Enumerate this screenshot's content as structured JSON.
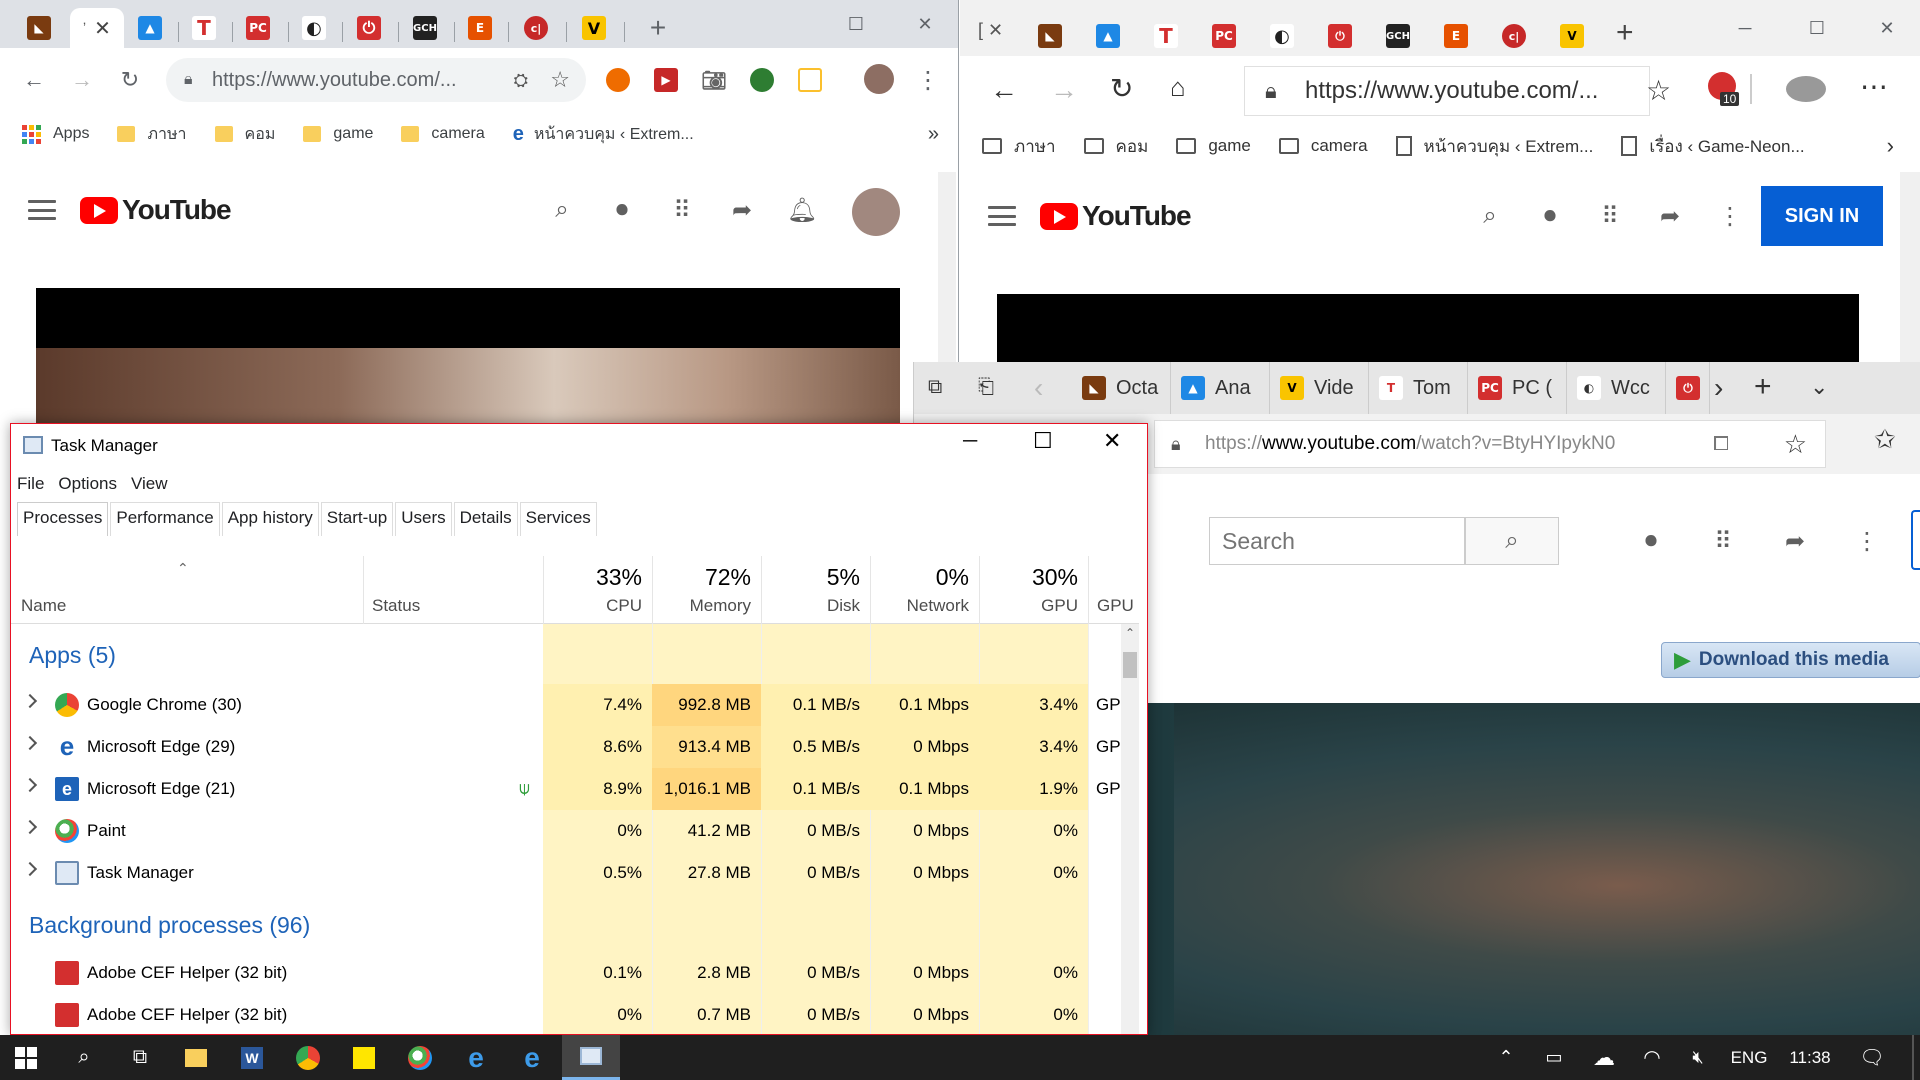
{
  "chrome": {
    "tabs": [
      {
        "icon": "game-icon",
        "color": "#b5651d"
      },
      {
        "title": "ʼ",
        "active": true
      },
      {
        "icon": "arch-icon",
        "color": "#1e88e5"
      },
      {
        "icon": "t-icon",
        "color": "#d32f2f",
        "glyph": "T"
      },
      {
        "icon": "pcgames-icon",
        "color": "#d32f2f",
        "glyph": "PC"
      },
      {
        "icon": "gauntlet-icon",
        "color": "#333333"
      },
      {
        "icon": "power-icon",
        "color": "#d32f2f"
      },
      {
        "icon": "gch-icon",
        "color": "#222222",
        "glyph": "GCH"
      },
      {
        "icon": "e-icon",
        "color": "#e65100",
        "glyph": "E"
      },
      {
        "icon": "c-icon",
        "color": "#c62828",
        "glyph": "c|"
      },
      {
        "icon": "v-icon",
        "color": "#f9c400",
        "glyph": "V"
      }
    ],
    "url": "https://www.youtube.com/...",
    "bookmarks": [
      {
        "label": "Apps",
        "type": "apps"
      },
      {
        "label": "ภาษา",
        "type": "folder"
      },
      {
        "label": "คอม",
        "type": "folder"
      },
      {
        "label": "game",
        "type": "folder"
      },
      {
        "label": "camera",
        "type": "folder"
      },
      {
        "label": "หน้าควบคุม ‹ Extrem...",
        "type": "page"
      }
    ],
    "bookmarks_more": "»",
    "youtube_logo": "YouTube"
  },
  "edge": {
    "url": "https://www.youtube.com/...",
    "extension_badge": "10",
    "bookmarks": [
      {
        "label": "ภาษา",
        "type": "folder"
      },
      {
        "label": "คอม",
        "type": "folder"
      },
      {
        "label": "game",
        "type": "folder"
      },
      {
        "label": "camera",
        "type": "folder"
      },
      {
        "label": "หน้าควบคุม ‹ Extrem...",
        "type": "page"
      },
      {
        "label": "เรื่อง ‹ Game-Neon...",
        "type": "page"
      }
    ],
    "youtube_logo": "YouTube",
    "sign_in": "SIGN IN"
  },
  "oldedge": {
    "tabs": [
      "Octa",
      "Ana",
      "Vide",
      "Tom",
      "PC (",
      "Wcc"
    ],
    "url_prefix": "https://",
    "url_host": "www.youtube.com",
    "url_path": "/watch?v=BtyHYIpykN0",
    "search_placeholder": "Search",
    "download_media": "Download this media"
  },
  "taskmgr": {
    "title": "Task Manager",
    "menu": [
      "File",
      "Options",
      "View"
    ],
    "tabs": [
      "Processes",
      "Performance",
      "App history",
      "Start-up",
      "Users",
      "Details",
      "Services"
    ],
    "columns": {
      "name": "Name",
      "status": "Status",
      "cpu": {
        "pct": "33%",
        "label": "CPU"
      },
      "memory": {
        "pct": "72%",
        "label": "Memory"
      },
      "disk": {
        "pct": "5%",
        "label": "Disk"
      },
      "network": {
        "pct": "0%",
        "label": "Network"
      },
      "gpu": {
        "pct": "30%",
        "label": "GPU"
      },
      "gpu_engine": "GPU E"
    },
    "groups": {
      "apps": "Apps (5)",
      "background": "Background processes (96)"
    },
    "apps": [
      {
        "name": "Google Chrome (30)",
        "icon": "chrome-icon",
        "cpu": "7.4%",
        "mem": "992.8 MB",
        "disk": "0.1 MB/s",
        "net": "0.1 Mbps",
        "gpu": "3.4%",
        "gpue": "GPU"
      },
      {
        "name": "Microsoft Edge (29)",
        "icon": "edge-icon",
        "cpu": "8.6%",
        "mem": "913.4 MB",
        "disk": "0.5 MB/s",
        "net": "0 Mbps",
        "gpu": "3.4%",
        "gpue": "GPU"
      },
      {
        "name": "Microsoft Edge (21)",
        "icon": "edge-legacy-icon",
        "cpu": "8.9%",
        "mem": "1,016.1 MB",
        "disk": "0.1 MB/s",
        "net": "0.1 Mbps",
        "gpu": "1.9%",
        "gpue": "GPU"
      },
      {
        "name": "Paint",
        "icon": "paint-icon",
        "cpu": "0%",
        "mem": "41.2 MB",
        "disk": "0 MB/s",
        "net": "0 Mbps",
        "gpu": "0%",
        "gpue": ""
      },
      {
        "name": "Task Manager",
        "icon": "taskmgr-icon",
        "cpu": "0.5%",
        "mem": "27.8 MB",
        "disk": "0 MB/s",
        "net": "0 Mbps",
        "gpu": "0%",
        "gpue": ""
      }
    ],
    "background": [
      {
        "name": "Adobe CEF Helper (32 bit)",
        "icon": "adobe-icon",
        "cpu": "0.1%",
        "mem": "2.8 MB",
        "disk": "0 MB/s",
        "net": "0 Mbps",
        "gpu": "0%"
      },
      {
        "name": "Adobe CEF Helper (32 bit)",
        "icon": "adobe-icon",
        "cpu": "0%",
        "mem": "0.7 MB",
        "disk": "0 MB/s",
        "net": "0 Mbps",
        "gpu": "0%"
      }
    ]
  },
  "taskbar": {
    "language": "ENG",
    "time": "11:38"
  }
}
